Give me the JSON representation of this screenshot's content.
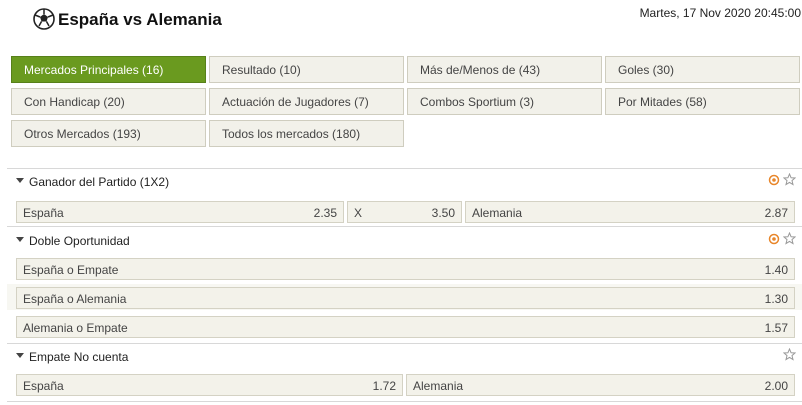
{
  "match": {
    "title": "España vs Alemania",
    "datetime": "Martes, 17 Nov 2020 20:45:00"
  },
  "tabs": [
    {
      "label": "Mercados Principales (16)",
      "active": true
    },
    {
      "label": "Resultado (10)"
    },
    {
      "label": "Más de/Menos de (43)"
    },
    {
      "label": "Goles (30)"
    },
    {
      "label": "Con Handicap (20)"
    },
    {
      "label": "Actuación de Jugadores (7)"
    },
    {
      "label": "Combos Sportium (3)"
    },
    {
      "label": "Por Mitades (58)"
    },
    {
      "label": "Otros Mercados (193)"
    },
    {
      "label": "Todos los mercados (180)"
    }
  ],
  "markets": [
    {
      "title": "Ganador del Partido (1X2)",
      "odds": [
        {
          "label": "España",
          "value": "2.35"
        },
        {
          "label": "X",
          "value": "3.50"
        },
        {
          "label": "Alemania",
          "value": "2.87"
        }
      ]
    },
    {
      "title": "Doble Oportunidad",
      "odds": [
        {
          "label": "España o Empate",
          "value": "1.40"
        },
        {
          "label": "España o Alemania",
          "value": "1.30"
        },
        {
          "label": "Alemania o Empate",
          "value": "1.57"
        }
      ]
    },
    {
      "title": "Empate No cuenta",
      "odds": [
        {
          "label": "España",
          "value": "1.72"
        },
        {
          "label": "Alemania",
          "value": "2.00"
        }
      ]
    }
  ],
  "colors": {
    "accent": "#6a9a1f",
    "live_icon": "#e8862a"
  }
}
